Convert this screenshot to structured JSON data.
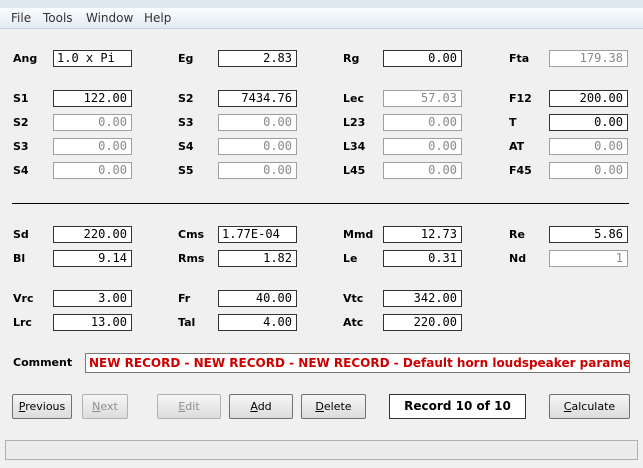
{
  "menu": [
    "File",
    "Tools",
    "Window",
    "Help"
  ],
  "fields": {
    "ang": {
      "label": "Ang",
      "value": "1.0 x Pi"
    },
    "eg": {
      "label": "Eg",
      "value": "2.83"
    },
    "rg": {
      "label": "Rg",
      "value": "0.00"
    },
    "fta": {
      "label": "Fta",
      "value": "179.38"
    },
    "s1": {
      "label": "S1",
      "value": "122.00"
    },
    "s2b": {
      "label": "S2",
      "value": "7434.76"
    },
    "lec": {
      "label": "Lec",
      "value": "57.03"
    },
    "f12": {
      "label": "F12",
      "value": "200.00"
    },
    "s2": {
      "label": "S2",
      "value": "0.00"
    },
    "s3b": {
      "label": "S3",
      "value": "0.00"
    },
    "l23": {
      "label": "L23",
      "value": "0.00"
    },
    "t": {
      "label": "T",
      "value": "0.00"
    },
    "s3": {
      "label": "S3",
      "value": "0.00"
    },
    "s4b": {
      "label": "S4",
      "value": "0.00"
    },
    "l34": {
      "label": "L34",
      "value": "0.00"
    },
    "at": {
      "label": "AT",
      "value": "0.00"
    },
    "s4": {
      "label": "S4",
      "value": "0.00"
    },
    "s5": {
      "label": "S5",
      "value": "0.00"
    },
    "l45": {
      "label": "L45",
      "value": "0.00"
    },
    "f45": {
      "label": "F45",
      "value": "0.00"
    },
    "sd": {
      "label": "Sd",
      "value": "220.00"
    },
    "cms": {
      "label": "Cms",
      "value": "1.77E-04"
    },
    "mmd": {
      "label": "Mmd",
      "value": "12.73"
    },
    "re": {
      "label": "Re",
      "value": "5.86"
    },
    "bl": {
      "label": "Bl",
      "value": "9.14"
    },
    "rms": {
      "label": "Rms",
      "value": "1.82"
    },
    "le": {
      "label": "Le",
      "value": "0.31"
    },
    "nd": {
      "label": "Nd",
      "value": "1"
    },
    "vrc": {
      "label": "Vrc",
      "value": "3.00"
    },
    "fr": {
      "label": "Fr",
      "value": "40.00"
    },
    "vtc": {
      "label": "Vtc",
      "value": "342.00"
    },
    "lrc": {
      "label": "Lrc",
      "value": "13.00"
    },
    "tal": {
      "label": "Tal",
      "value": "4.00"
    },
    "atc": {
      "label": "Atc",
      "value": "220.00"
    }
  },
  "comment": {
    "label": "Comment",
    "value": "NEW RECORD - NEW RECORD - NEW RECORD - Default horn loudspeaker parameters"
  },
  "buttons": {
    "previous": {
      "first": "P",
      "rest": "revious"
    },
    "next": {
      "first": "N",
      "rest": "ext"
    },
    "edit": {
      "first": "E",
      "rest": "dit"
    },
    "add": {
      "first": "A",
      "rest": "dd"
    },
    "delete": {
      "first": "D",
      "rest": "elete"
    },
    "calculate": {
      "first": "C",
      "rest": "alculate"
    }
  },
  "record_indicator": "Record 10 of 10",
  "colors": {
    "comment_text": "#cc0000",
    "disabled_text": "#8d8d8d"
  }
}
